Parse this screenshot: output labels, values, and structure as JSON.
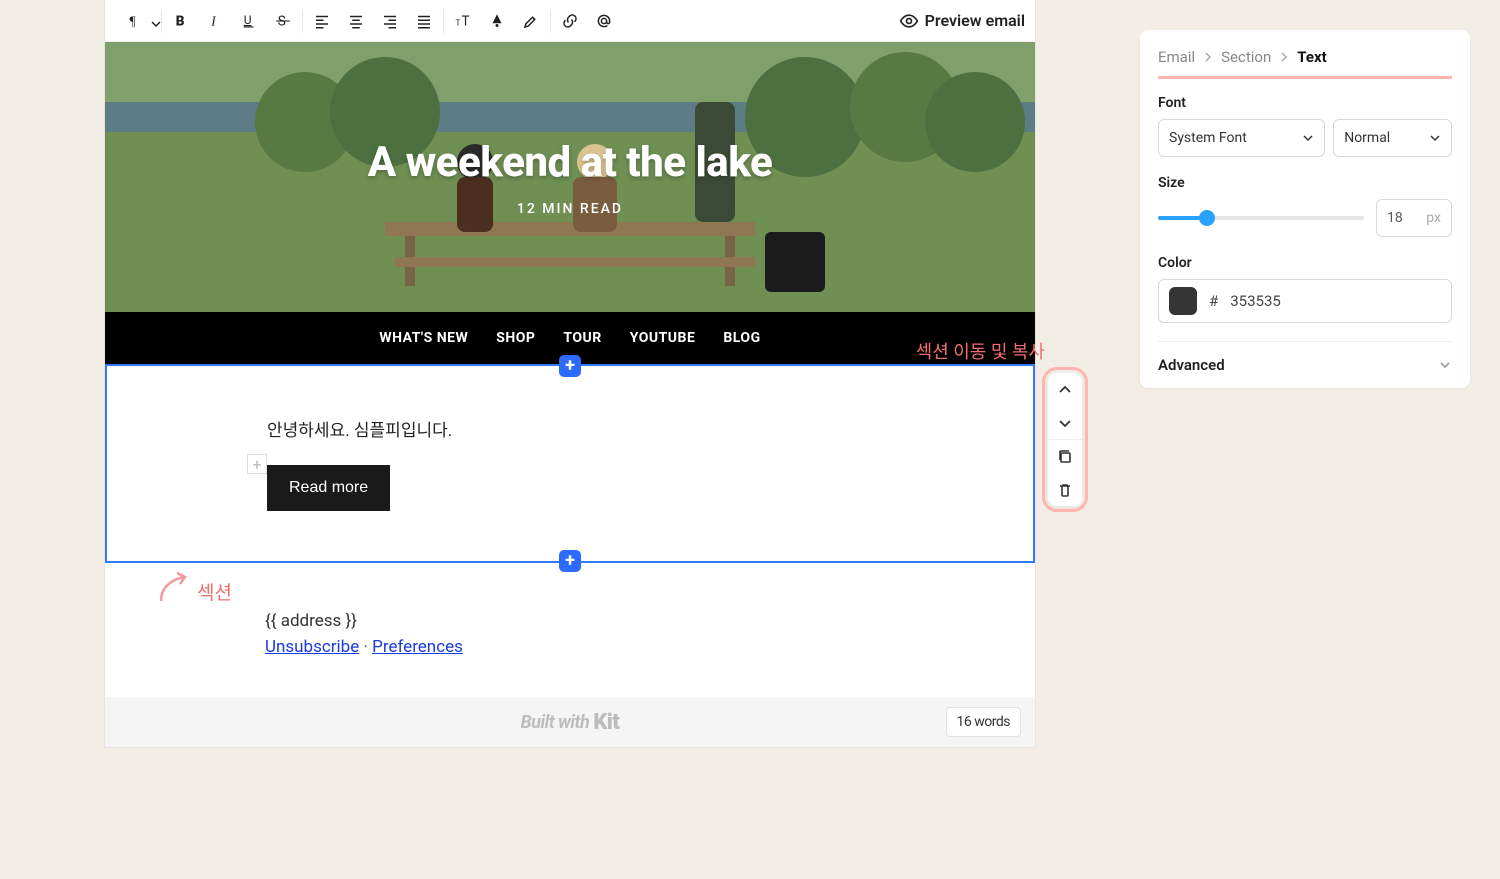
{
  "toolbar": {
    "preview_label": "Preview email"
  },
  "hero": {
    "title": "A weekend at the lake",
    "subtitle": "12 MIN READ"
  },
  "nav": {
    "items": [
      "WHAT'S NEW",
      "SHOP",
      "TOUR",
      "YOUTUBE",
      "BLOG"
    ]
  },
  "section": {
    "greeting": "안녕하세요. 심플피입니다.",
    "read_more_label": "Read more"
  },
  "annotations": {
    "section_label": "섹션",
    "actions_label": "섹션 이동 및 복사"
  },
  "footer": {
    "address_template": "{{ address }}",
    "unsubscribe": "Unsubscribe",
    "preferences": "Preferences",
    "builtwith_prefix": "Built with",
    "builtwith_brand": "Kit",
    "words_count": "16 words"
  },
  "sidebar": {
    "crumbs": {
      "email": "Email",
      "section": "Section",
      "text": "Text"
    },
    "font": {
      "label": "Font",
      "family_selected": "System Font",
      "weight_selected": "Normal"
    },
    "size": {
      "label": "Size",
      "value": "18",
      "unit": "px",
      "slider_percent": 24
    },
    "color": {
      "label": "Color",
      "prefix": "#",
      "hex": "353535"
    },
    "advanced_label": "Advanced"
  }
}
